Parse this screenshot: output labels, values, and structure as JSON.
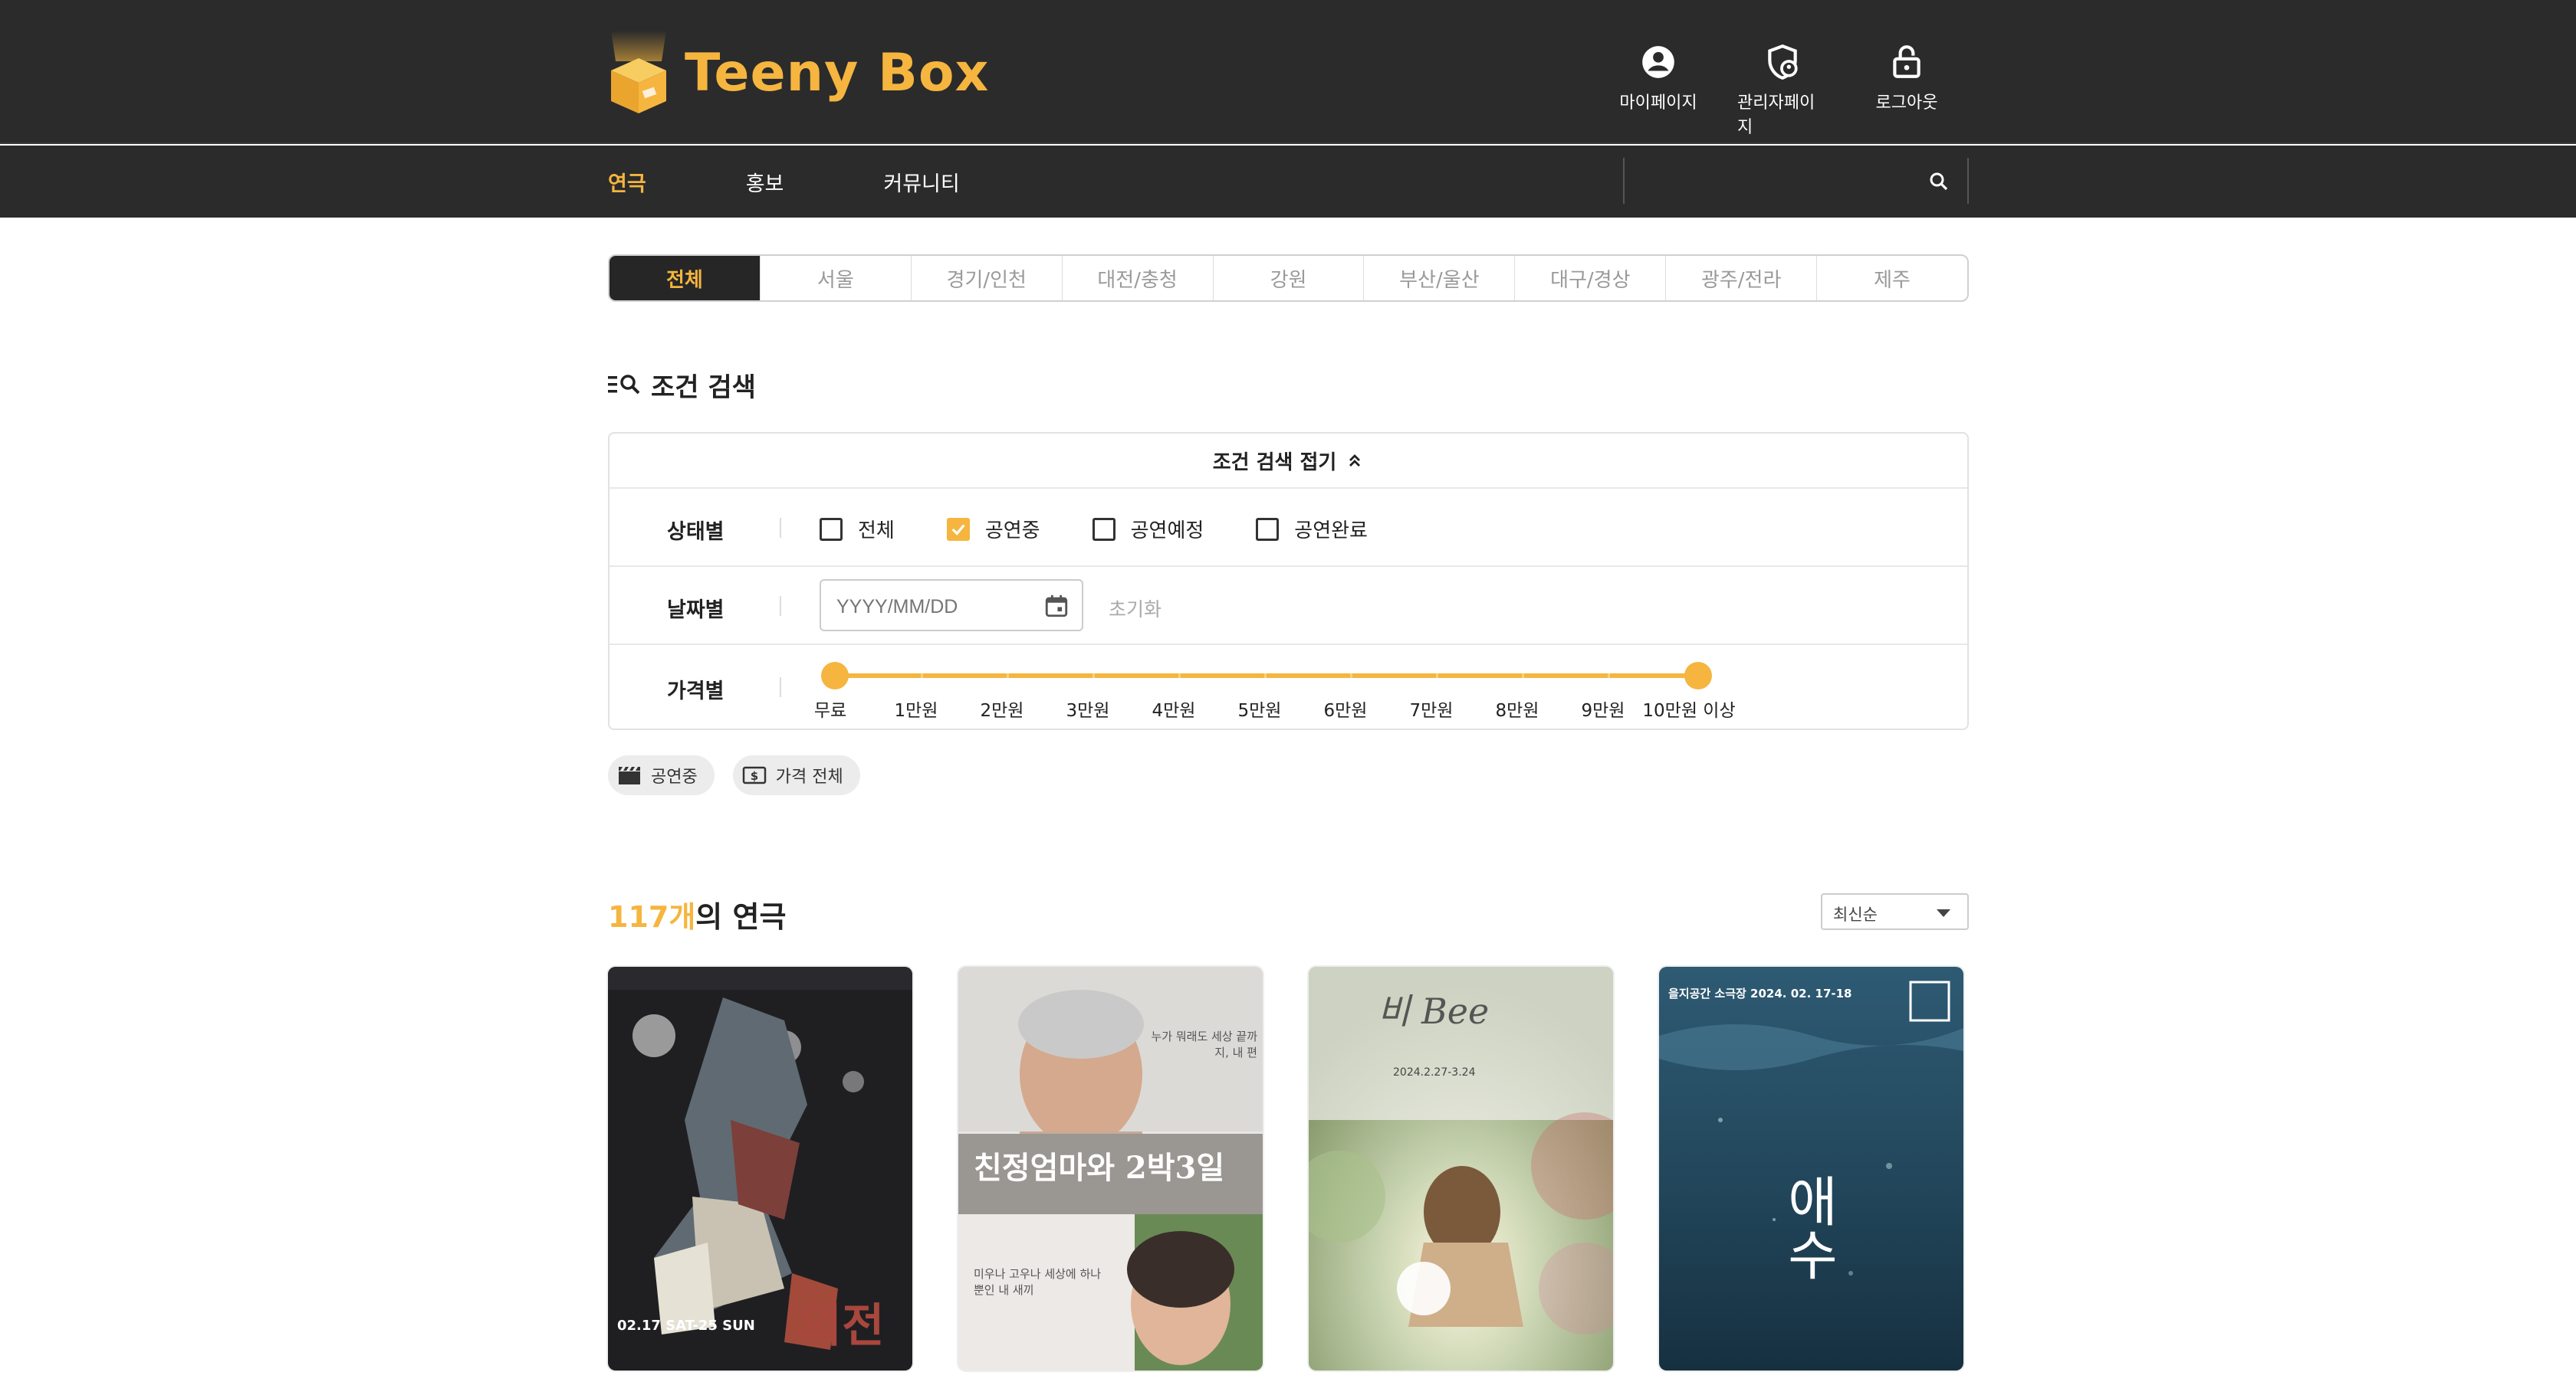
{
  "header": {
    "logo_text_1": "Teeny B",
    "logo_text_2": "ox",
    "actions": [
      {
        "label": "마이페이지",
        "icon": "account-circle-icon"
      },
      {
        "label": "관리자페이지",
        "icon": "admin-shield-icon"
      },
      {
        "label": "로그아웃",
        "icon": "unlock-icon"
      }
    ]
  },
  "nav": {
    "items": [
      "연극",
      "홍보",
      "커뮤니티"
    ],
    "active": "연극",
    "search_placeholder": ""
  },
  "regions": {
    "items": [
      "전체",
      "서울",
      "경기/인천",
      "대전/충청",
      "강원",
      "부산/울산",
      "대구/경상",
      "광주/전라",
      "제주"
    ],
    "active": "전체"
  },
  "condition_search": {
    "title": "조건 검색",
    "collapse_label": "조건 검색 접기",
    "status": {
      "label": "상태별",
      "options": [
        {
          "label": "전체",
          "checked": false
        },
        {
          "label": "공연중",
          "checked": true
        },
        {
          "label": "공연예정",
          "checked": false
        },
        {
          "label": "공연완료",
          "checked": false
        }
      ]
    },
    "date": {
      "label": "날짜별",
      "placeholder": "YYYY/MM/DD",
      "reset_label": "초기화"
    },
    "price": {
      "label": "가격별",
      "ticks": [
        "무료",
        "1만원",
        "2만원",
        "3만원",
        "4만원",
        "5만원",
        "6만원",
        "7만원",
        "8만원",
        "9만원",
        "10만원 이상"
      ],
      "selected_min": "무료",
      "selected_max": "10만원 이상"
    }
  },
  "chips": [
    {
      "label": "공연중",
      "icon": "clapperboard-icon"
    },
    {
      "label": "가격 전체",
      "icon": "dollar-bill-icon"
    }
  ],
  "results": {
    "count": "117개",
    "suffix": "의 연극",
    "sort_value": "최신순"
  },
  "posters": [
    {
      "title_text": "외전",
      "date_text": "02.17 SAT-25 SUN"
    },
    {
      "title_text": "친정엄마와 2박3일",
      "quote_top": "누가 뭐래도 세상 끝까지, 내 편",
      "quote_bottom": "미우나 고우나 세상에 하나 뿐인 내 새끼"
    },
    {
      "title_text": "비 Bee",
      "sub_text": "2024.2.27-3.24"
    },
    {
      "title_text": "애수",
      "header_text": "을지공간 소극장 2024. 02. 17-18"
    }
  ],
  "colors": {
    "accent": "#f5b53f",
    "dark": "#2b2b2b"
  }
}
